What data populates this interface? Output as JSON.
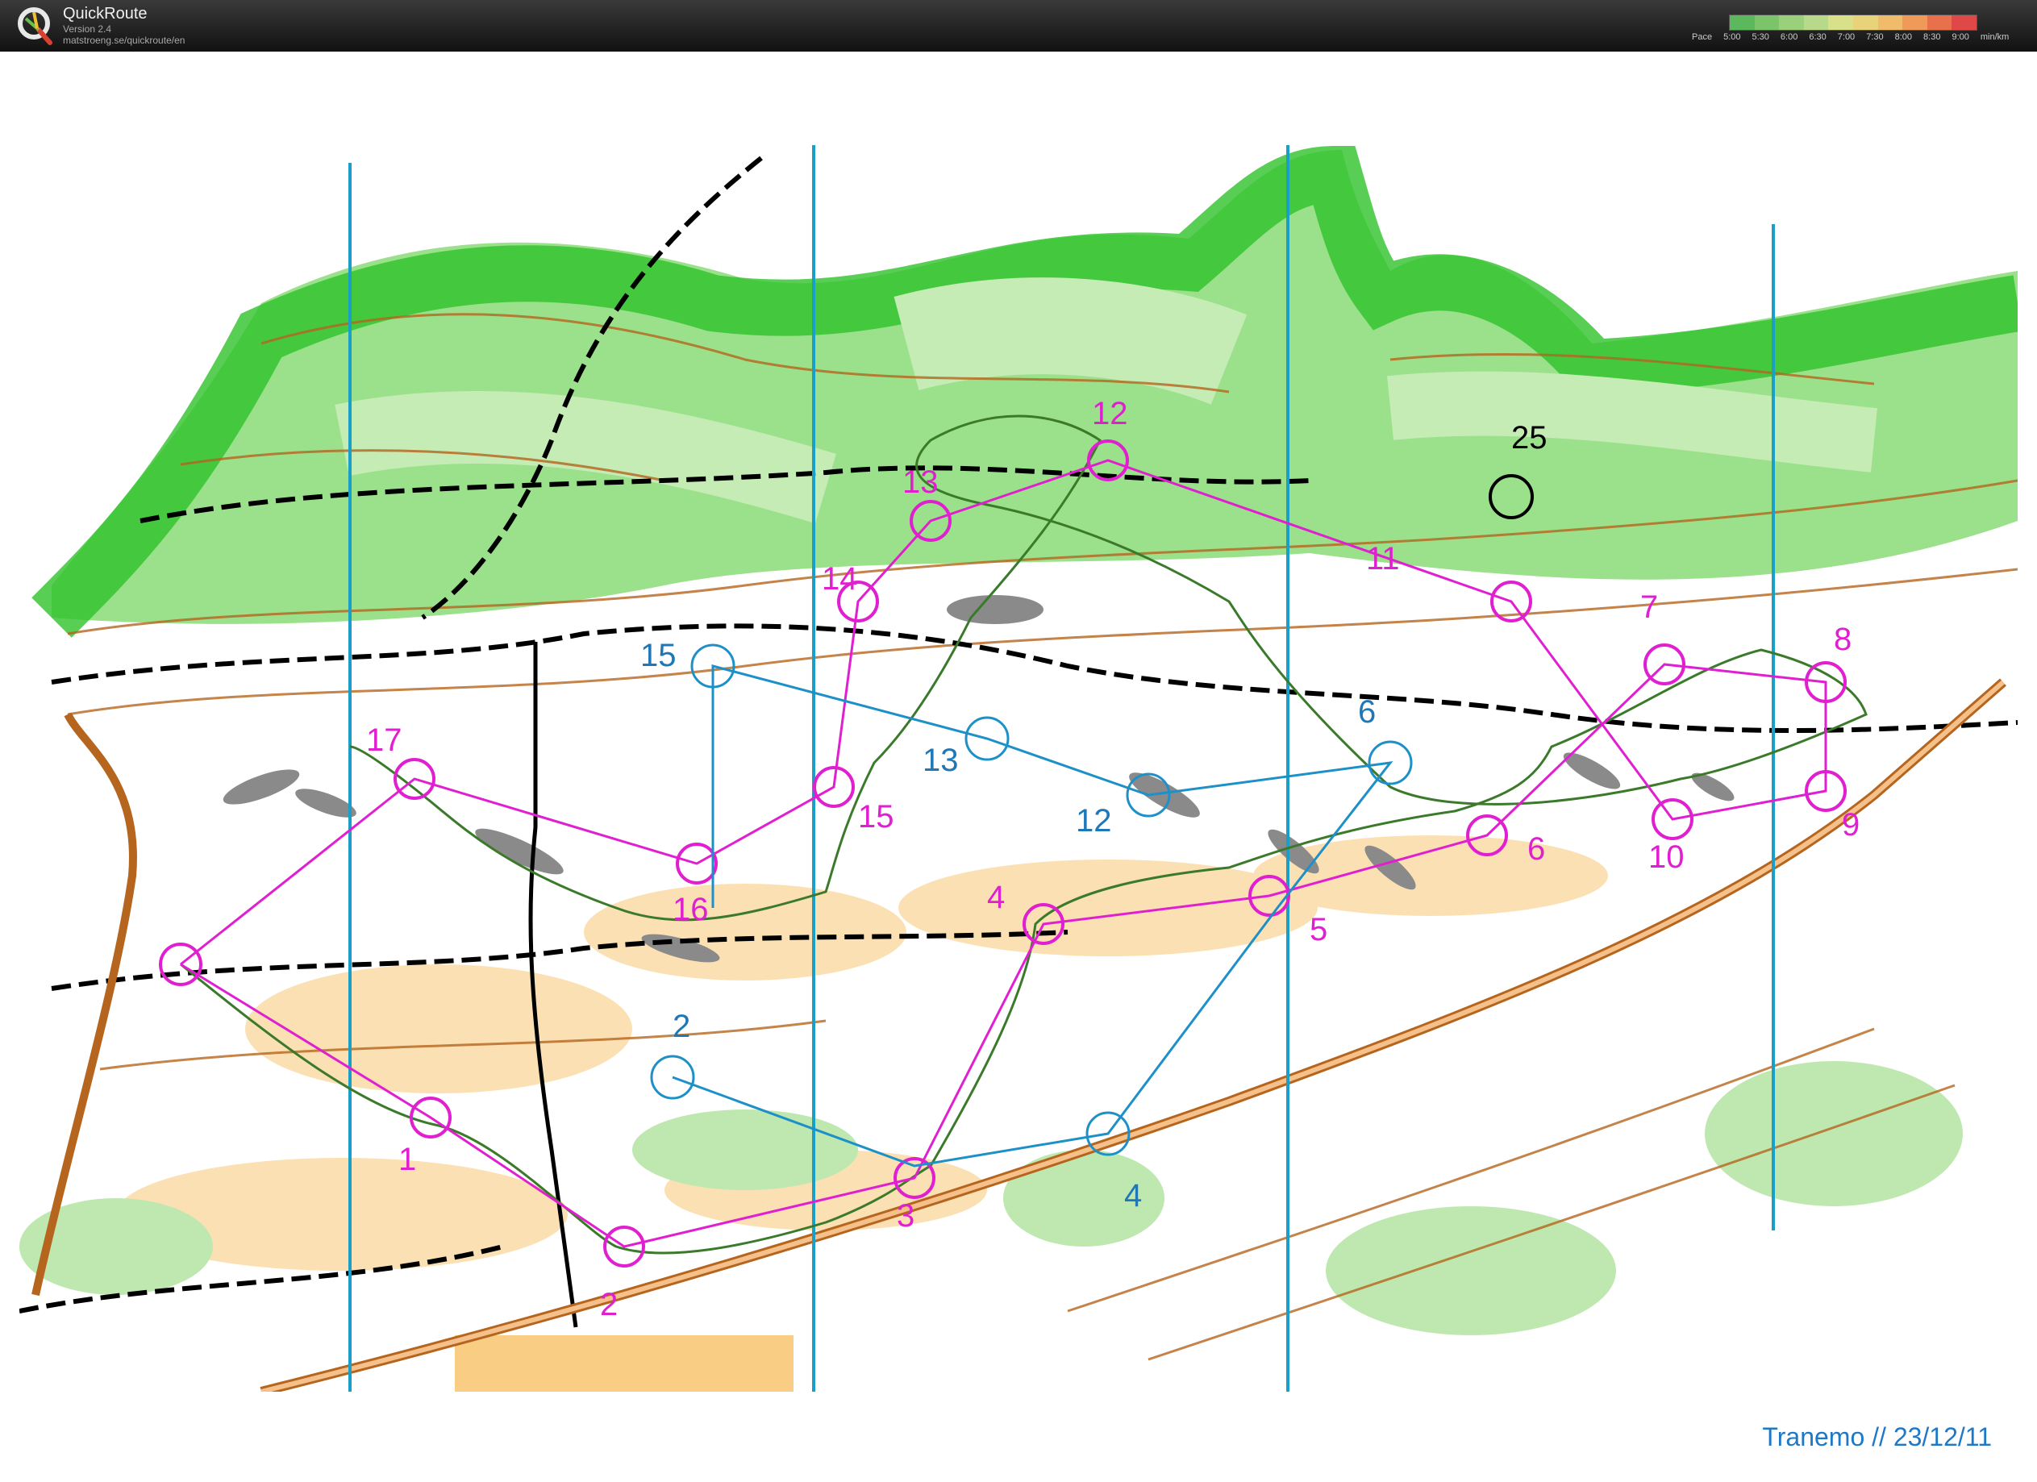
{
  "app": {
    "name": "QuickRoute",
    "version": "Version 2.4",
    "url": "matstroeng.se/quickroute/en"
  },
  "pace_legend": {
    "prefix": "Pace",
    "labels": [
      "5:00",
      "5:30",
      "6:00",
      "6:30",
      "7:00",
      "7:30",
      "8:00",
      "8:30",
      "9:00"
    ],
    "unit": "min/km",
    "colors": [
      "#5cb85c",
      "#7cc46a",
      "#9ad07a",
      "#b8d88a",
      "#d8e08a",
      "#e8d37a",
      "#f0bb6a",
      "#f09a5a",
      "#e8704a",
      "#e04848"
    ]
  },
  "map": {
    "caption": "Tranemo  //  23/12/11",
    "course_color": "#e020d0",
    "route_color": "#1e90c8",
    "magenta_controls": [
      "1",
      "2",
      "3",
      "4",
      "5",
      "6",
      "7",
      "8",
      "9",
      "10",
      "11",
      "12",
      "13",
      "14",
      "15",
      "16",
      "17"
    ],
    "blue_controls": [
      "2",
      "4",
      "6",
      "12",
      "13",
      "15"
    ],
    "black_controls": [
      "25"
    ]
  }
}
